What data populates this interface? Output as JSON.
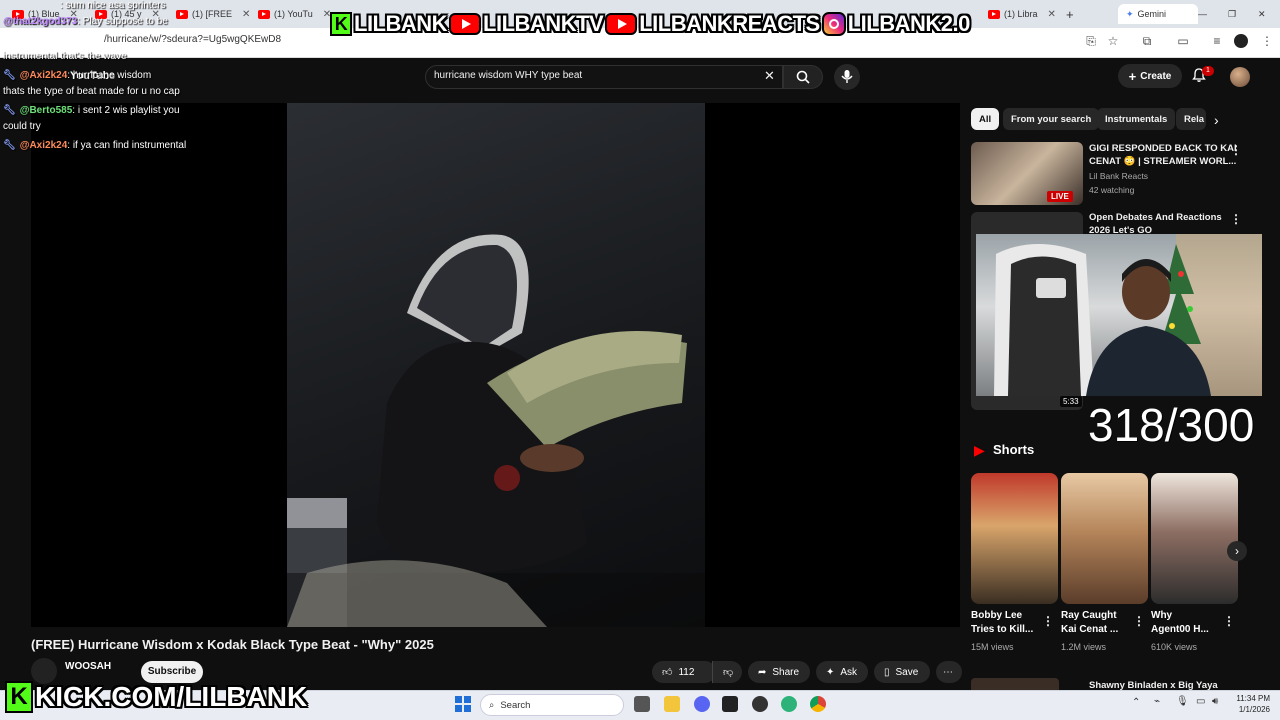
{
  "browser": {
    "tabs": [
      {
        "label": "(1) Blue"
      },
      {
        "label": "(1) 45 y"
      },
      {
        "label": "(1) [FREE"
      },
      {
        "label": "(1) YouTu"
      },
      {
        "label": "(1) Libra"
      },
      {
        "label": "Gemini"
      }
    ],
    "url": "/hurricane/w/?sdeura?=Ug5wgQKEwD8",
    "new_tab_symbol": "+"
  },
  "overlay": {
    "banner": [
      {
        "icon": "kick-icon",
        "text": "LILBANK"
      },
      {
        "icon": "youtube-icon",
        "text": "LILBANKTV"
      },
      {
        "icon": "youtube-icon",
        "text": "LILBANKREACTS"
      },
      {
        "icon": "instagram-icon",
        "text": "LILBANK2.0"
      }
    ],
    "counter": "318/300",
    "kick_url": "KICK.COM/LILBANK",
    "chat": [
      {
        "user": "@that2kgod373",
        "text": ": Play suppose to be"
      },
      {
        "user": "",
        "text": "instrumental that's the wave"
      },
      {
        "user": "@Axi2k24",
        "text": ": hurricane wisdom"
      },
      {
        "user": "",
        "text": "thats the type of beat made for u no cap"
      },
      {
        "user": "@Berto585",
        "text": ": i sent 2 wis playlist you"
      },
      {
        "user": "",
        "text": "could try"
      },
      {
        "user": "@Axi2k24",
        "text": ": if ya can find instrumental"
      }
    ],
    "chat_top": ": sum nice asa sprinters"
  },
  "youtube": {
    "logo": "YouTube",
    "search_query": "hurricane wisdom WHY type beat",
    "create_label": "Create",
    "notification_count": "1",
    "video": {
      "title": "(FREE) Hurricane Wisdom x Kodak Black Type Beat - \"Why\" 2025",
      "channel": "WOOSAH",
      "subscribe": "Subscribe",
      "likes": "112",
      "share": "Share",
      "ask": "Ask",
      "save": "Save"
    },
    "chips": [
      {
        "label": "All",
        "active": true
      },
      {
        "label": "From your search",
        "active": false
      },
      {
        "label": "Instrumentals",
        "active": false
      },
      {
        "label": "Rela",
        "active": false
      }
    ],
    "recommendations": [
      {
        "title_line1": "GIGI RESPONDED BACK TO KAI",
        "title_line2": "CENAT 😳 | STREAMER WORL...",
        "channel": "Lil Bank Reacts",
        "meta": "42 watching",
        "badge": "LIVE"
      },
      {
        "title_line1": "Open Debates And Reactions",
        "title_line2": "2026 Let's GO",
        "channel": "",
        "meta": "",
        "badge": "5:33"
      }
    ],
    "shorts_label": "Shorts",
    "shorts": [
      {
        "title_line1": "Bobby Lee",
        "title_line2": "Tries to Kill...",
        "views": "15M views"
      },
      {
        "title_line1": "Ray Caught",
        "title_line2": "Kai Cenat ...",
        "views": "1.2M views"
      },
      {
        "title_line1": "Why",
        "title_line2": "Agent00 H...",
        "views": "610K views"
      }
    ],
    "next_rec_title": "Shawny Binladen x Big Yaya"
  },
  "taskbar": {
    "search_placeholder": "Search",
    "time": "11:34 PM",
    "date": "1/1/2026"
  },
  "colors": {
    "yt_bg": "#0f0f0f",
    "kick_green": "#53fc18",
    "youtube_red": "#ff0000",
    "chip_bg": "#272727"
  }
}
